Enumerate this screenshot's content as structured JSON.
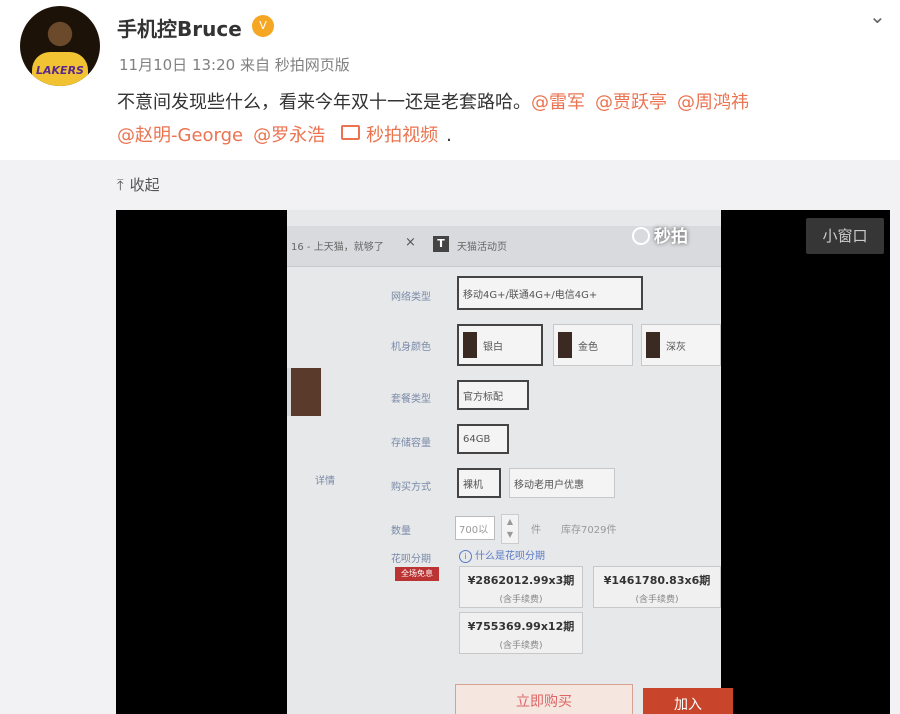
{
  "post": {
    "author": "手机控Bruce",
    "avatar_text": "LAKERS",
    "vip_badge": "V",
    "time": "11月10日 13:20",
    "source": "来自 秒拍网页版",
    "text": "不意间发现些什么，看来今年双十一还是老套路哈。",
    "mentions_line1": [
      "@雷军",
      "@贾跃亭",
      "@周鸿祎"
    ],
    "mentions_line2": [
      "@赵明-George",
      "@罗永浩"
    ],
    "video_link": "秒拍视频",
    "trailing": ".",
    "collapse_label": "收起"
  },
  "video": {
    "mini_window": "小窗口",
    "watermark": "秒拍",
    "tabs": [
      {
        "label": "16 - 上天猫，就够了"
      },
      {
        "label": "天猫活动页",
        "icon_letter": "T"
      }
    ],
    "tab_close": "×",
    "form": {
      "network_label": "网络类型",
      "network_value": "移动4G+/联通4G+/电信4G+",
      "color_label": "机身颜色",
      "colors": [
        "银白",
        "金色",
        "深灰"
      ],
      "package_label": "套餐类型",
      "package_value": "官方标配",
      "storage_label": "存储容量",
      "storage_value": "64GB",
      "purchase_label": "购买方式",
      "purchase_options": [
        "裸机",
        "移动老用户优惠"
      ],
      "side_text": "详情",
      "qty_label": "数量",
      "qty_value": "700以",
      "qty_unit": "件",
      "stock": "库存7029件",
      "installment_label": "花呗分期",
      "installment_info": "什么是花呗分期",
      "installment_tag": "全场免息",
      "installments": [
        {
          "price": "¥2862012.99x3期",
          "note": "(含手续费)"
        },
        {
          "price": "¥1461780.83x6期",
          "note": "(含手续费)"
        },
        {
          "price": "¥755369.99x12期",
          "note": "(含手续费)"
        }
      ],
      "buy_now": "立即购买",
      "add_cart": "加入"
    }
  },
  "colors": {
    "link": "#eb7350",
    "meta": "#808080"
  }
}
